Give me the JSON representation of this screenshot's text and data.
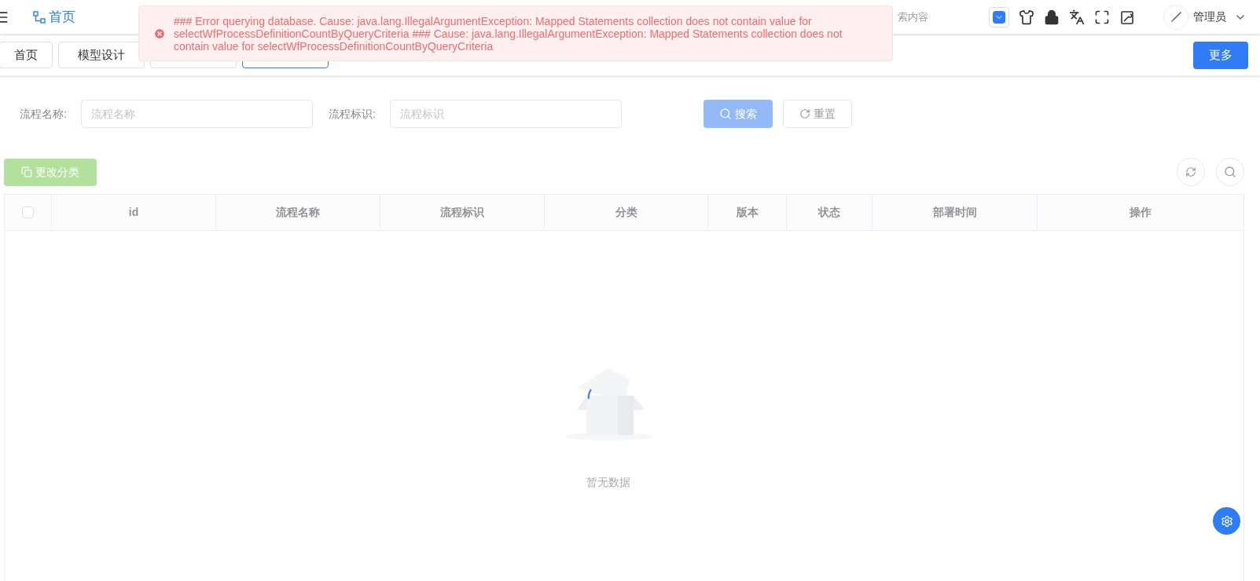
{
  "header": {
    "breadcrumb": "首页",
    "search_fragment": "索内容",
    "user": "管理员"
  },
  "tags": [
    {
      "label": "首页",
      "selected": false
    },
    {
      "label": "模型设计",
      "selected": false
    },
    {
      "selected": false
    },
    {
      "selected": true
    }
  ],
  "more_button": "更多",
  "toast": {
    "kind": "error",
    "message": "### Error querying database. Cause: java.lang.IllegalArgumentException: Mapped Statements collection does not contain value for selectWfProcessDefinitionCountByQueryCriteria ### Cause: java.lang.IllegalArgumentException: Mapped Statements collection does not contain value for selectWfProcessDefinitionCountByQueryCriteria"
  },
  "search_form": {
    "fields": [
      {
        "label": "流程名称:",
        "placeholder": "流程名称"
      },
      {
        "label": "流程标识:",
        "placeholder": "流程标识"
      }
    ],
    "search_button": "搜索",
    "reset_button": "重置"
  },
  "toolbar": {
    "change_category_button": "更改分类",
    "disabled": true
  },
  "table": {
    "columns": [
      "id",
      "流程名称",
      "流程标识",
      "分类",
      "版本",
      "状态",
      "部署时间",
      "操作"
    ],
    "select_all_checked": false,
    "empty_text": "暂无数据"
  }
}
